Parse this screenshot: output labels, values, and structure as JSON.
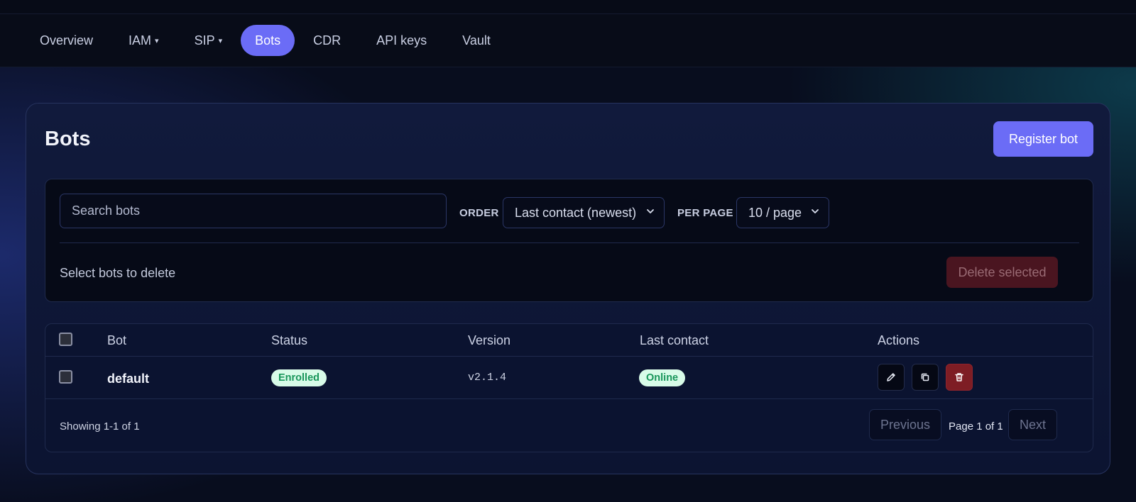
{
  "nav": {
    "items": [
      {
        "label": "Overview",
        "dropdown": false,
        "active": false
      },
      {
        "label": "IAM",
        "dropdown": true,
        "active": false
      },
      {
        "label": "SIP",
        "dropdown": true,
        "active": false
      },
      {
        "label": "Bots",
        "dropdown": false,
        "active": true
      },
      {
        "label": "CDR",
        "dropdown": false,
        "active": false
      },
      {
        "label": "API keys",
        "dropdown": false,
        "active": false
      },
      {
        "label": "Vault",
        "dropdown": false,
        "active": false
      }
    ],
    "caret": "▾"
  },
  "page": {
    "title": "Bots",
    "register_label": "Register bot"
  },
  "filters": {
    "search_placeholder": "Search bots",
    "search_value": "",
    "order_label": "ORDER",
    "order_value": "Last contact (newest)",
    "per_page_label": "PER PAGE",
    "per_page_value": "10 / page",
    "hint": "Select bots to delete",
    "delete_label": "Delete selected"
  },
  "table": {
    "headers": {
      "bot": "Bot",
      "status": "Status",
      "version": "Version",
      "last_contact": "Last contact",
      "actions": "Actions"
    },
    "rows": [
      {
        "name": "default",
        "status": "Enrolled",
        "version": "v2.1.4",
        "last_contact": "Online"
      }
    ],
    "footer": {
      "showing": "Showing 1-1 of 1",
      "previous": "Previous",
      "page_label": "Page 1 of 1",
      "next": "Next"
    }
  },
  "colors": {
    "accent": "#6b6cf6",
    "danger": "#7e1d24",
    "badge_bg": "#d8fbe8",
    "badge_text": "#18965a"
  },
  "icons": [
    "chevron-down-icon",
    "pencil-icon",
    "copy-icon",
    "trash-icon"
  ]
}
